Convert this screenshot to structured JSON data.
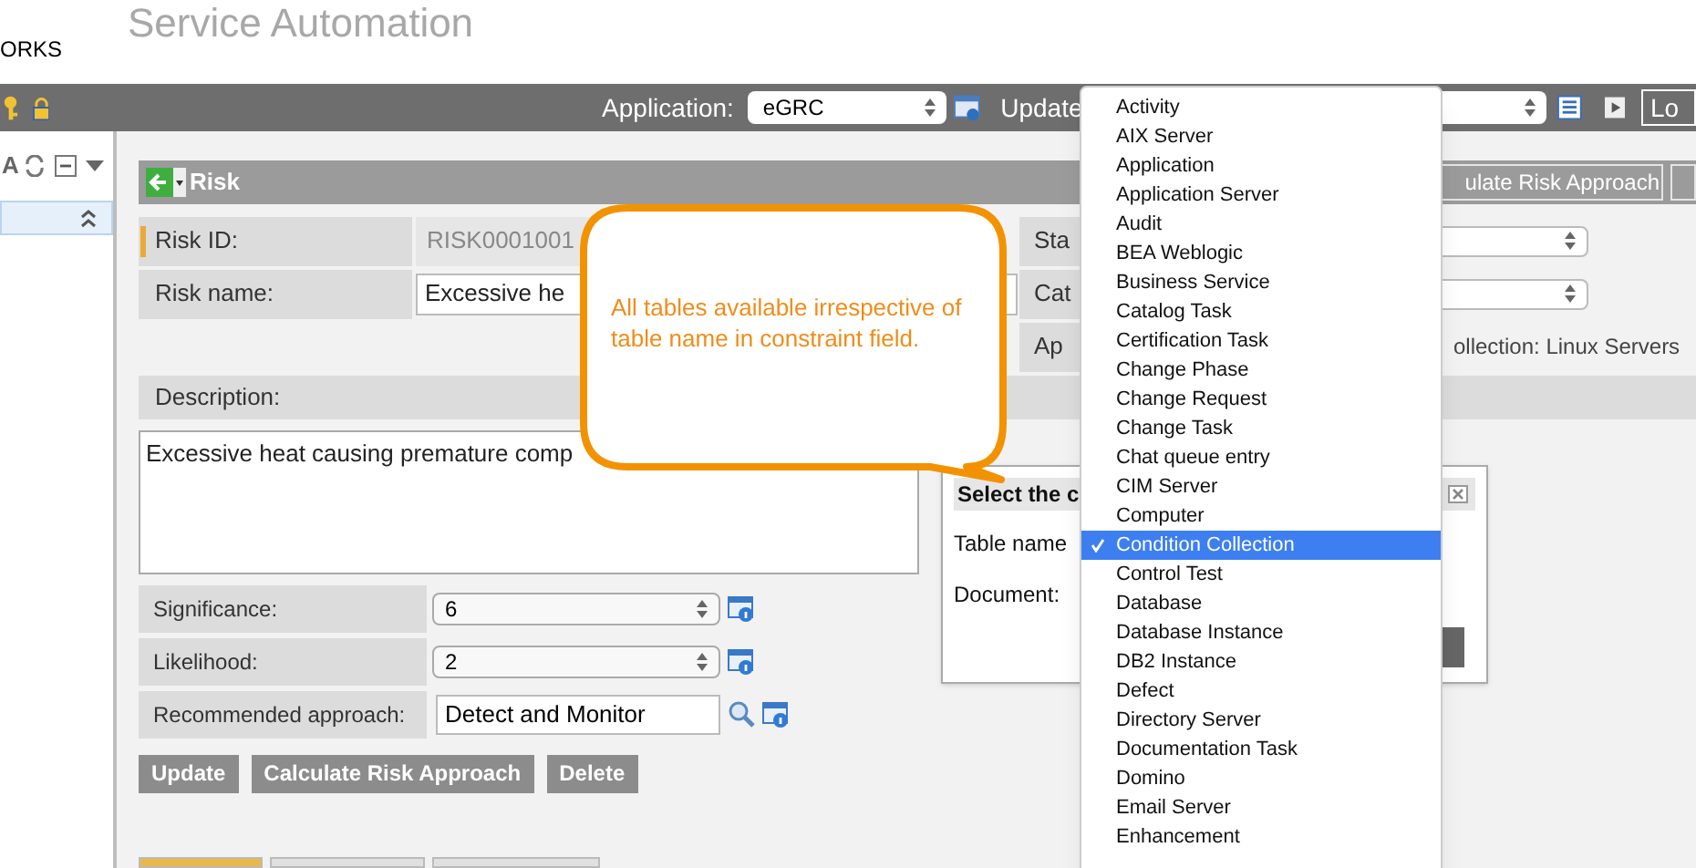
{
  "header": {
    "logo_text": "ORKS",
    "title": "Service Automation"
  },
  "top_bar": {
    "application_label": "Application:",
    "application_value": "eGRC",
    "update_label": "Update",
    "logout_button": "Lo"
  },
  "left_panel": {
    "toolbar_glyph": "A",
    "items": [
      {
        "selected": true
      }
    ]
  },
  "risk_panel": {
    "title": "Risk",
    "header_buttons": [
      "ulate Risk Approach"
    ],
    "left_fields": [
      {
        "kind": "readonly",
        "label": "Risk ID:",
        "value": "RISK0001001",
        "required": true
      },
      {
        "kind": "input",
        "label": "Risk name:",
        "value": "Excessive he",
        "required": false
      }
    ],
    "right_fields": [
      {
        "kind": "select",
        "label": "Sta"
      },
      {
        "kind": "select",
        "label": "Cat"
      },
      {
        "kind": "text",
        "label": "Ap",
        "value": "ollection: Linux Servers"
      }
    ],
    "description_label": "Description:",
    "description": "Excessive heat causing premature comp",
    "lower_fields": [
      {
        "kind": "select",
        "label": "Significance:",
        "value": "6"
      },
      {
        "kind": "select",
        "label": "Likelihood:",
        "value": "2"
      },
      {
        "kind": "lookup",
        "label": "Recommended approach:",
        "value": "Detect and Monitor"
      }
    ],
    "buttons": [
      "Update",
      "Calculate Risk Approach",
      "Delete"
    ],
    "bottom_tabs": [
      {
        "selected": true
      },
      {
        "selected": false
      },
      {
        "selected": false
      }
    ]
  },
  "dialog": {
    "title": "Select the c",
    "table_label": "Table name",
    "document_label": "Document:"
  },
  "callout": {
    "text": "All tables available irrespective of table name in constraint field."
  },
  "dropdown": {
    "items": [
      {
        "label": "Activity",
        "selected": false
      },
      {
        "label": "AIX Server",
        "selected": false
      },
      {
        "label": "Application",
        "selected": false
      },
      {
        "label": "Application Server",
        "selected": false
      },
      {
        "label": "Audit",
        "selected": false
      },
      {
        "label": "BEA Weblogic",
        "selected": false
      },
      {
        "label": "Business Service",
        "selected": false
      },
      {
        "label": "Catalog Task",
        "selected": false
      },
      {
        "label": "Certification Task",
        "selected": false
      },
      {
        "label": "Change Phase",
        "selected": false
      },
      {
        "label": "Change Request",
        "selected": false
      },
      {
        "label": "Change Task",
        "selected": false
      },
      {
        "label": "Chat queue entry",
        "selected": false
      },
      {
        "label": "CIM Server",
        "selected": false
      },
      {
        "label": "Computer",
        "selected": false
      },
      {
        "label": "Condition Collection",
        "selected": true
      },
      {
        "label": "Control Test",
        "selected": false
      },
      {
        "label": "Database",
        "selected": false
      },
      {
        "label": "Database Instance",
        "selected": false
      },
      {
        "label": "DB2 Instance",
        "selected": false
      },
      {
        "label": "Defect",
        "selected": false
      },
      {
        "label": "Directory Server",
        "selected": false
      },
      {
        "label": "Documentation Task",
        "selected": false
      },
      {
        "label": "Domino",
        "selected": false
      },
      {
        "label": "Email Server",
        "selected": false
      },
      {
        "label": "Enhancement",
        "selected": false
      }
    ]
  }
}
